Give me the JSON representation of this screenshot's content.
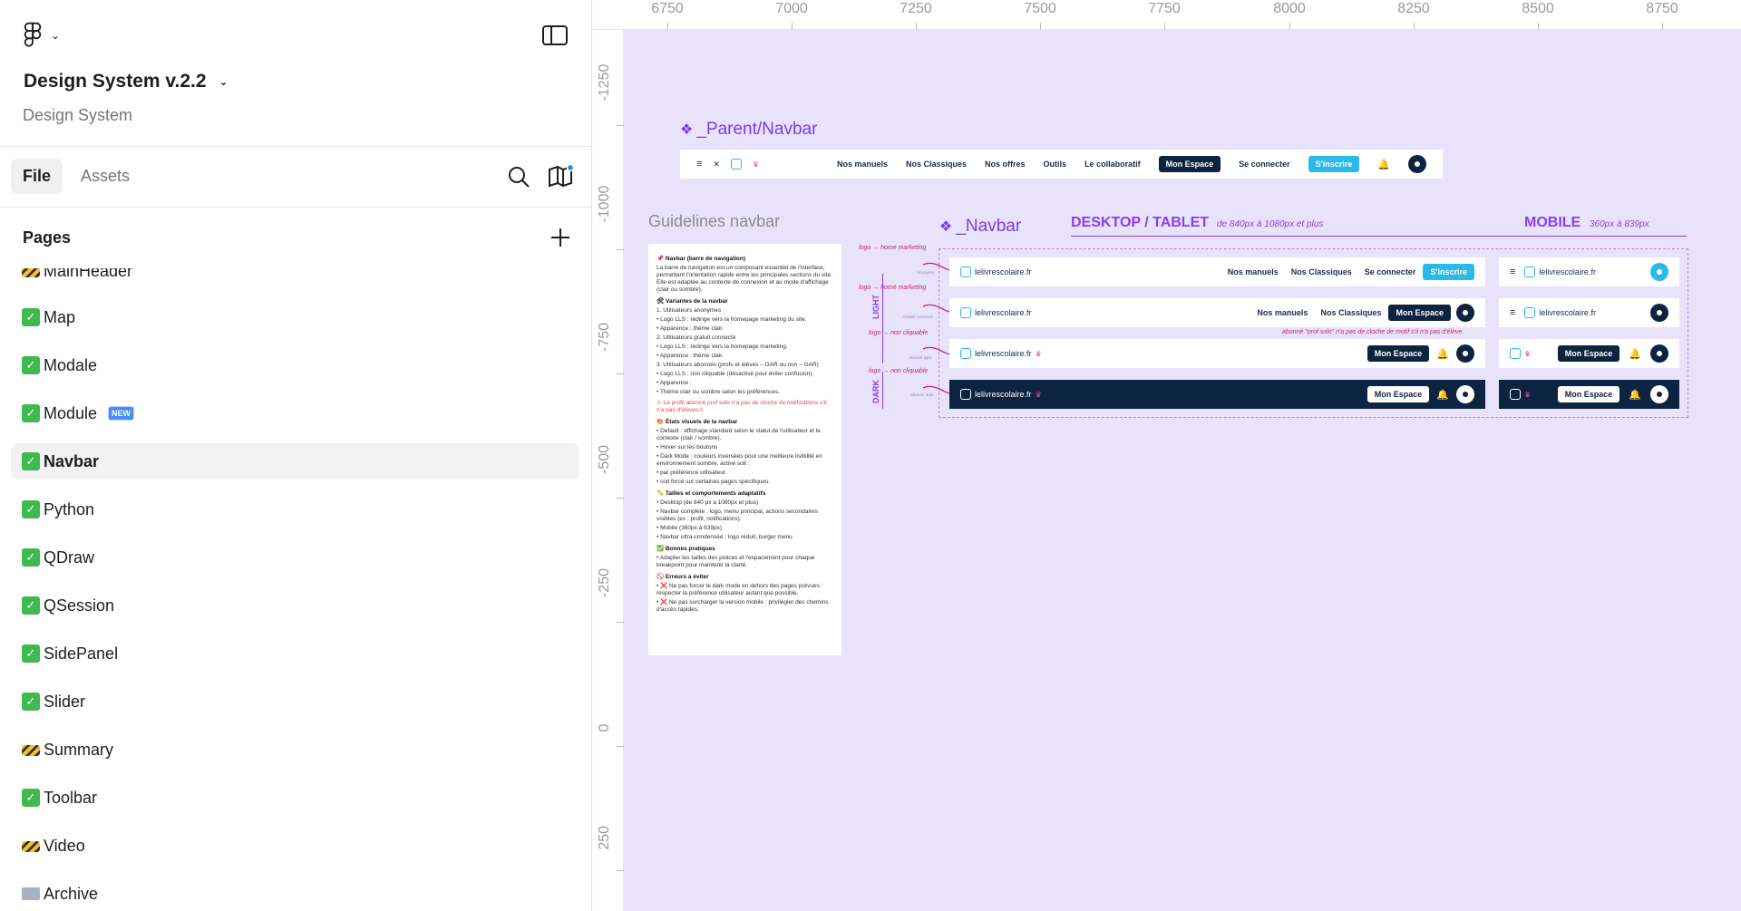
{
  "app": {
    "file_title": "Design System v.2.2",
    "file_subtitle": "Design System"
  },
  "tabs": {
    "file": "File",
    "assets": "Assets"
  },
  "pages": {
    "title": "Pages",
    "items": [
      {
        "icon": "construction",
        "label": "MainHeader"
      },
      {
        "icon": "check",
        "label": "Map"
      },
      {
        "icon": "check",
        "label": "Modale"
      },
      {
        "icon": "check",
        "label": "Module",
        "badge": "NEW"
      },
      {
        "icon": "check",
        "label": "Navbar",
        "active": true
      },
      {
        "icon": "check",
        "label": "Python"
      },
      {
        "icon": "check",
        "label": "QDraw"
      },
      {
        "icon": "check",
        "label": "QSession"
      },
      {
        "icon": "check",
        "label": "SidePanel"
      },
      {
        "icon": "check",
        "label": "Slider"
      },
      {
        "icon": "construction",
        "label": "Summary"
      },
      {
        "icon": "check",
        "label": "Toolbar"
      },
      {
        "icon": "construction",
        "label": "Video"
      },
      {
        "icon": "folder",
        "label": "Archive"
      }
    ]
  },
  "ruler": {
    "top": [
      "6750",
      "7000",
      "7250",
      "7500",
      "7750",
      "8000",
      "8250",
      "8500",
      "8750"
    ],
    "left": [
      "-1250",
      "-1000",
      "-750",
      "-500",
      "-250",
      "0",
      "250"
    ]
  },
  "canvas": {
    "parent_navbar_label": "_Parent/Navbar",
    "guidelines_label": "Guidelines navbar",
    "navbar_label": "_Navbar",
    "desktop_title": "DESKTOP / TABLET",
    "desktop_sub": "de 840px à 1080px et plus",
    "mobile_title": "MOBILE",
    "mobile_sub": "360px à 839px",
    "light_tag": "LIGHT",
    "dark_tag": "DARK",
    "anno_home_marketing": "logo → home marketing",
    "anno_non_cliquable": "logo → non cliquable",
    "anno_prof_solo": "abonné \"prof solo\" n'a pas de cloche de motif s'il n'a pas d'élève.",
    "anno_anonyme": "Anonyme",
    "anno_gratuit": "Gratuit connecté",
    "anno_abonne_light": "Abonné light",
    "anno_abonne_dark": "Abonné dark"
  },
  "navbar": {
    "menu": {
      "manuels": "Nos manuels",
      "classiques": "Nos Classiques",
      "offres": "Nos offres",
      "outils": "Outils",
      "collab": "Le collaboratif"
    },
    "mon_espace": "Mon Espace",
    "se_connecter": "Se connecter",
    "sinscrire": "S'inscrire",
    "logo_text": "lelivrescolaire.fr"
  },
  "guidelines": [
    {
      "type": "h",
      "text": "📌 Navbar (barre de navigation)"
    },
    {
      "type": "p",
      "text": "La barre de navigation est un composant essentiel de l'interface, permettant l'orientation rapide entre les principales sections du site. Elle est adaptée au contexte de connexion et au mode d'affichage (clair ou sombre)."
    },
    {
      "type": "h",
      "text": "🛠 Variantes de la navbar"
    },
    {
      "type": "p",
      "text": "1. Utilisateurs anonymes"
    },
    {
      "type": "p",
      "text": "• Logo LLS : redirige vers la homepage marketing du site."
    },
    {
      "type": "p",
      "text": "• Apparence : thème clair."
    },
    {
      "type": "p",
      "text": "2. Utilisateurs gratuit connecté"
    },
    {
      "type": "p",
      "text": "• Logo LLS : redirige vers la homepage marketing."
    },
    {
      "type": "p",
      "text": "• Apparence : thème clair."
    },
    {
      "type": "p",
      "text": "3. Utilisateurs abonnés (profs et élèves – GAR ou non – GAR)"
    },
    {
      "type": "p",
      "text": "• Logo LLS : non cliquable (désactivé pour éviter confusion)."
    },
    {
      "type": "p",
      "text": "• Apparence :"
    },
    {
      "type": "p",
      "text": "• Thème clair ou sombre selon les préférences."
    },
    {
      "type": "w",
      "text": "⚠ Le profil abonné prof solo n'a pas de cloche de notifications s'il n'a pas d'élèves⚠"
    },
    {
      "type": "h",
      "text": "🎨 États visuels de la navbar"
    },
    {
      "type": "p",
      "text": "• Default : affichage standard selon le statut de l'utilisateur et le contexte (clair / sombre)."
    },
    {
      "type": "p",
      "text": "• Hover sur les boutons"
    },
    {
      "type": "p",
      "text": "• Dark Mode : couleurs inversées pour une meilleure lisibilité en environnement sombre, activé soit :"
    },
    {
      "type": "p",
      "text": "• par préférence utilisateur."
    },
    {
      "type": "p",
      "text": "• soit forcé sur certaines pages spécifiques."
    },
    {
      "type": "h",
      "text": "📏 Tailles et comportements adaptatifs"
    },
    {
      "type": "p",
      "text": "• Desktop (de 840 px à 1080px et plus)"
    },
    {
      "type": "p",
      "text": "• Navbar complète : logo, menu principal, actions secondaires visibles (ex : profil, notifications)."
    },
    {
      "type": "p",
      "text": "• Mobile (360px à 839px)"
    },
    {
      "type": "p",
      "text": "• Navbar ultra-condensée : logo réduit, burger menu"
    },
    {
      "type": "h",
      "text": "✅ Bonnes pratiques"
    },
    {
      "type": "p",
      "text": "• Adapter les tailles des polices et l'espacement pour chaque breakpoint pour maintenir la clarté."
    },
    {
      "type": "h",
      "text": "🚫 Erreurs à éviter"
    },
    {
      "type": "p",
      "text": "• ❌ Ne pas forcer le dark mode en dehors des pages prévues : respecter la préférence utilisateur autant que possible."
    },
    {
      "type": "p",
      "text": "• ❌ Ne pas surcharger la version mobile : privilégier des chemins d'accès rapides."
    }
  ]
}
